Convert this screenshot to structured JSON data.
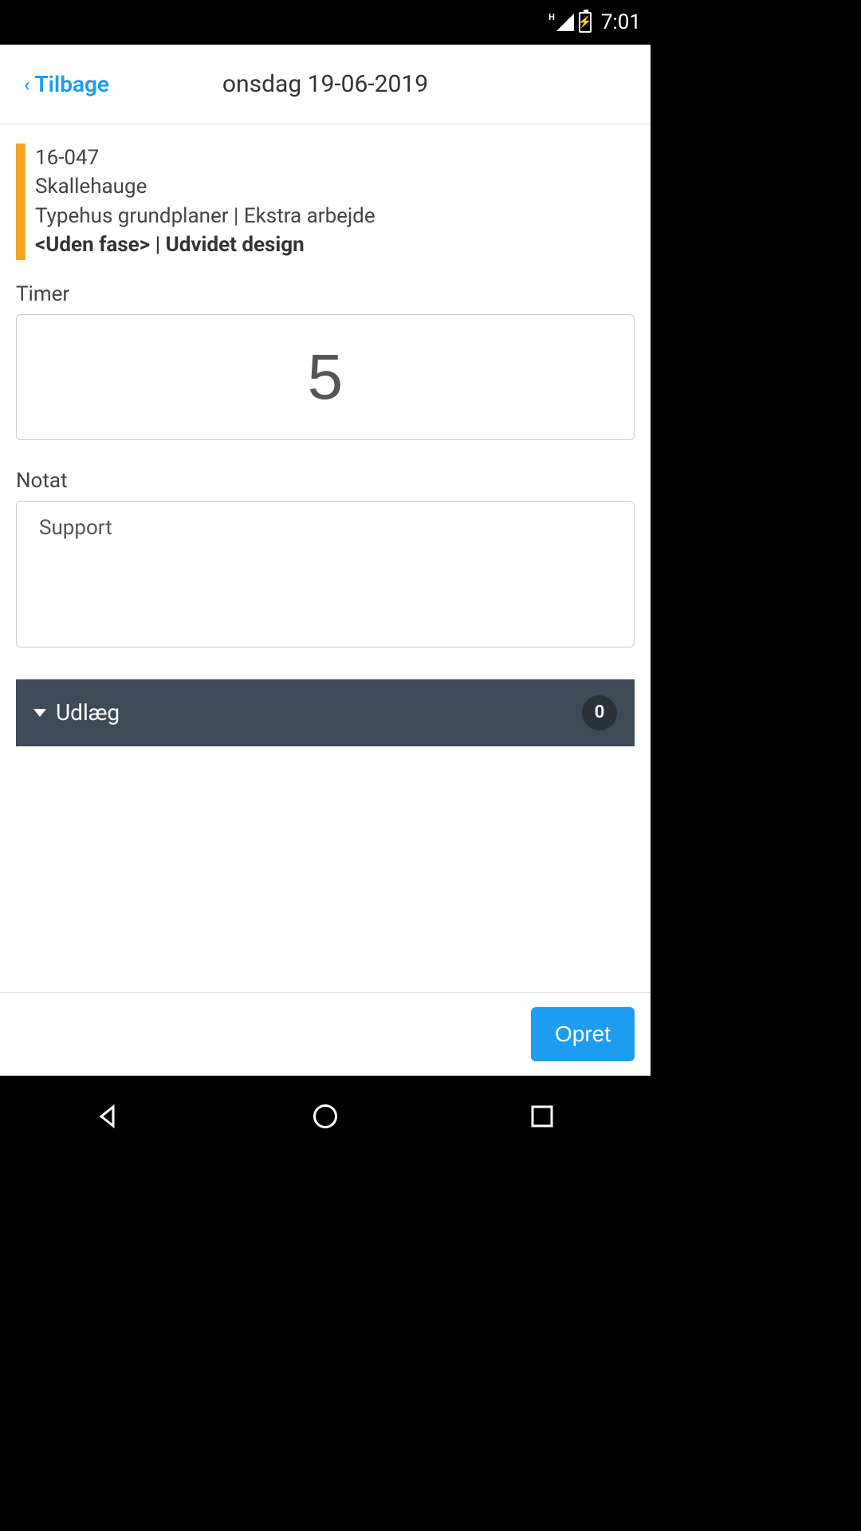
{
  "status": {
    "network_label": "H",
    "time": "7:01"
  },
  "header": {
    "back_label": "Tilbage",
    "title": "onsdag 19-06-2019"
  },
  "info": {
    "project_code": "16-047",
    "client": "Skallehauge",
    "task_line": "Typehus grundplaner | Ekstra arbejde",
    "phase_line": "<Uden fase> | Udvidet design"
  },
  "fields": {
    "timer_label": "Timer",
    "timer_value": "5",
    "notat_label": "Notat",
    "notat_value": "Support"
  },
  "expand": {
    "label": "Udlæg",
    "count": "0"
  },
  "footer": {
    "submit_label": "Opret"
  }
}
